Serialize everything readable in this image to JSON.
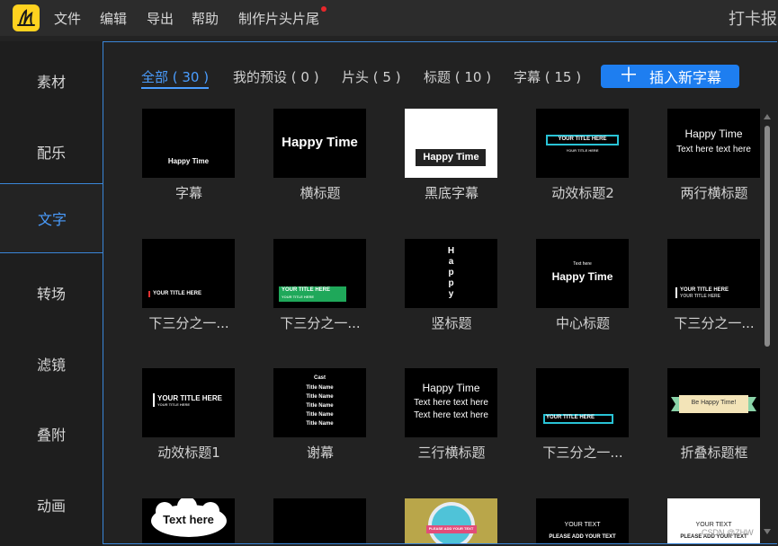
{
  "menubar": {
    "items": [
      "文件",
      "编辑",
      "导出",
      "帮助",
      "制作片头片尾"
    ],
    "title_right": "打卡报",
    "accent": "#ffd21f",
    "notice_color": "#e8272b"
  },
  "sidebar": {
    "items": [
      "素材",
      "配乐",
      "文字",
      "转场",
      "滤镜",
      "叠附",
      "动画"
    ],
    "active": "文字",
    "active_color": "#4a9dff"
  },
  "tabs": [
    {
      "label": "全部 ( 30 )",
      "active": true
    },
    {
      "label": "我的预设 ( 0 )",
      "active": false
    },
    {
      "label": "片头 ( 5 )",
      "active": false
    },
    {
      "label": "标题 ( 10 )",
      "active": false
    },
    {
      "label": "字幕 ( 15 )",
      "active": false
    }
  ],
  "insert_button": {
    "icon": "plus-icon",
    "label": "插入新字幕",
    "color": "#1e7ef0"
  },
  "templates": [
    {
      "label": "字幕",
      "thumb_lines": [
        "Happy Time"
      ]
    },
    {
      "label": "横标题",
      "thumb_lines": [
        "Happy Time"
      ]
    },
    {
      "label": "黑底字幕",
      "thumb_lines": [
        "Happy Time"
      ]
    },
    {
      "label": "动效标题2",
      "thumb_lines": [
        "YOUR TITLE HERE",
        "YOUR TITLE HERE"
      ]
    },
    {
      "label": "两行横标题",
      "thumb_lines": [
        "Happy Time",
        "Text here text here"
      ]
    },
    {
      "label": "下三分之一...",
      "thumb_lines": [
        "YOUR TITLE HERE"
      ]
    },
    {
      "label": "下三分之一...",
      "thumb_lines": [
        "YOUR TITLE HERE",
        "YOUR TITLE HERE"
      ]
    },
    {
      "label": "竖标题",
      "thumb_lines": [
        "H",
        "a",
        "p",
        "p",
        "y"
      ]
    },
    {
      "label": "中心标题",
      "thumb_lines": [
        "Text here",
        "Happy Time"
      ]
    },
    {
      "label": "下三分之一...",
      "thumb_lines": [
        "YOUR TITLE HERE",
        "YOUR TITLE HERE"
      ]
    },
    {
      "label": "动效标题1",
      "thumb_lines": [
        "YOUR TITLE HERE",
        "YOUR TITLE HERE"
      ]
    },
    {
      "label": "谢幕",
      "thumb_lines": [
        "Cast",
        "Title Name",
        "Title Name",
        "Title Name",
        "Title Name",
        "Title Name"
      ]
    },
    {
      "label": "三行横标题",
      "thumb_lines": [
        "Happy Time",
        "Text here text here",
        "Text here text here"
      ]
    },
    {
      "label": "下三分之一...",
      "thumb_lines": [
        "YOUR TITLE HERE"
      ]
    },
    {
      "label": "折叠标题框",
      "thumb_lines": [
        "Be Happy Time!"
      ]
    },
    {
      "label": "",
      "thumb_lines": [
        "Text here"
      ]
    },
    {
      "label": "",
      "thumb_lines": []
    },
    {
      "label": "",
      "thumb_lines": [
        "PLEASE ADD YOUR TEXT"
      ]
    },
    {
      "label": "",
      "thumb_lines": [
        "YOUR TEXT",
        "PLEASE ADD YOUR TEXT"
      ]
    },
    {
      "label": "",
      "thumb_lines": [
        "YOUR TEXT",
        "PLEASE ADD YOUR TEXT"
      ]
    }
  ],
  "watermark": "CSDN @ZHW"
}
